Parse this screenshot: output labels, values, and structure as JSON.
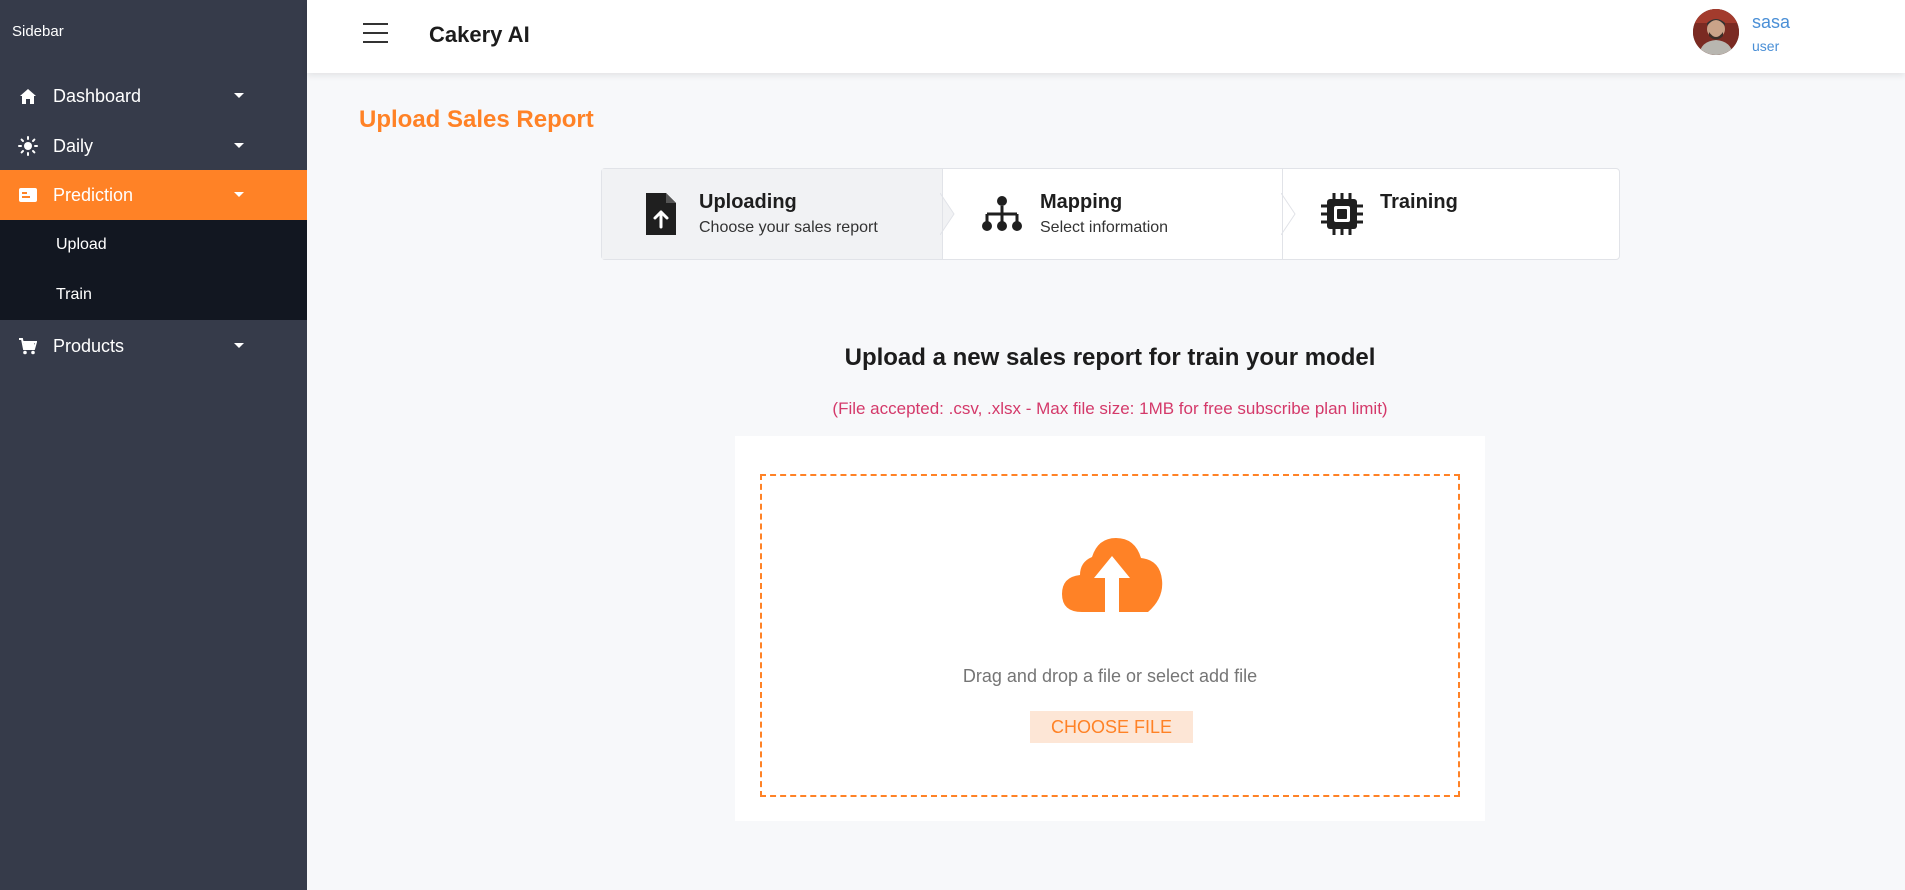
{
  "sidebar": {
    "title": "Sidebar",
    "items": [
      {
        "label": "Dashboard",
        "icon": "home-icon"
      },
      {
        "label": "Daily",
        "icon": "sun-icon"
      },
      {
        "label": "Prediction",
        "icon": "id-card-icon",
        "active": true,
        "children": [
          {
            "label": "Upload"
          },
          {
            "label": "Train"
          }
        ]
      },
      {
        "label": "Products",
        "icon": "cart-icon"
      }
    ]
  },
  "header": {
    "menu_icon": "hamburger-icon",
    "title": "Cakery AI",
    "user": {
      "name": "sasa",
      "role": "user"
    }
  },
  "main": {
    "page_title": "Upload Sales Report",
    "steps": [
      {
        "title": "Uploading",
        "subtitle": "Choose your sales report",
        "icon": "file-upload-icon",
        "active": true
      },
      {
        "title": "Mapping",
        "subtitle": "Select information",
        "icon": "sitemap-icon"
      },
      {
        "title": "Training",
        "subtitle": "",
        "icon": "chip-icon"
      }
    ],
    "upload": {
      "heading": "Upload a new sales report for train your model",
      "note": "(File accepted: .csv, .xlsx - Max file size: 1MB for free subscribe plan limit)",
      "drop_text": "Drag and drop a file or select add file",
      "button_label": "CHOOSE FILE",
      "icon": "cloud-upload-icon"
    }
  },
  "colors": {
    "accent": "#ff8226",
    "sidebar_bg": "#363b4a",
    "submenu_bg": "#121721",
    "note_color": "#d4396a",
    "user_color": "#4a8fd6"
  }
}
